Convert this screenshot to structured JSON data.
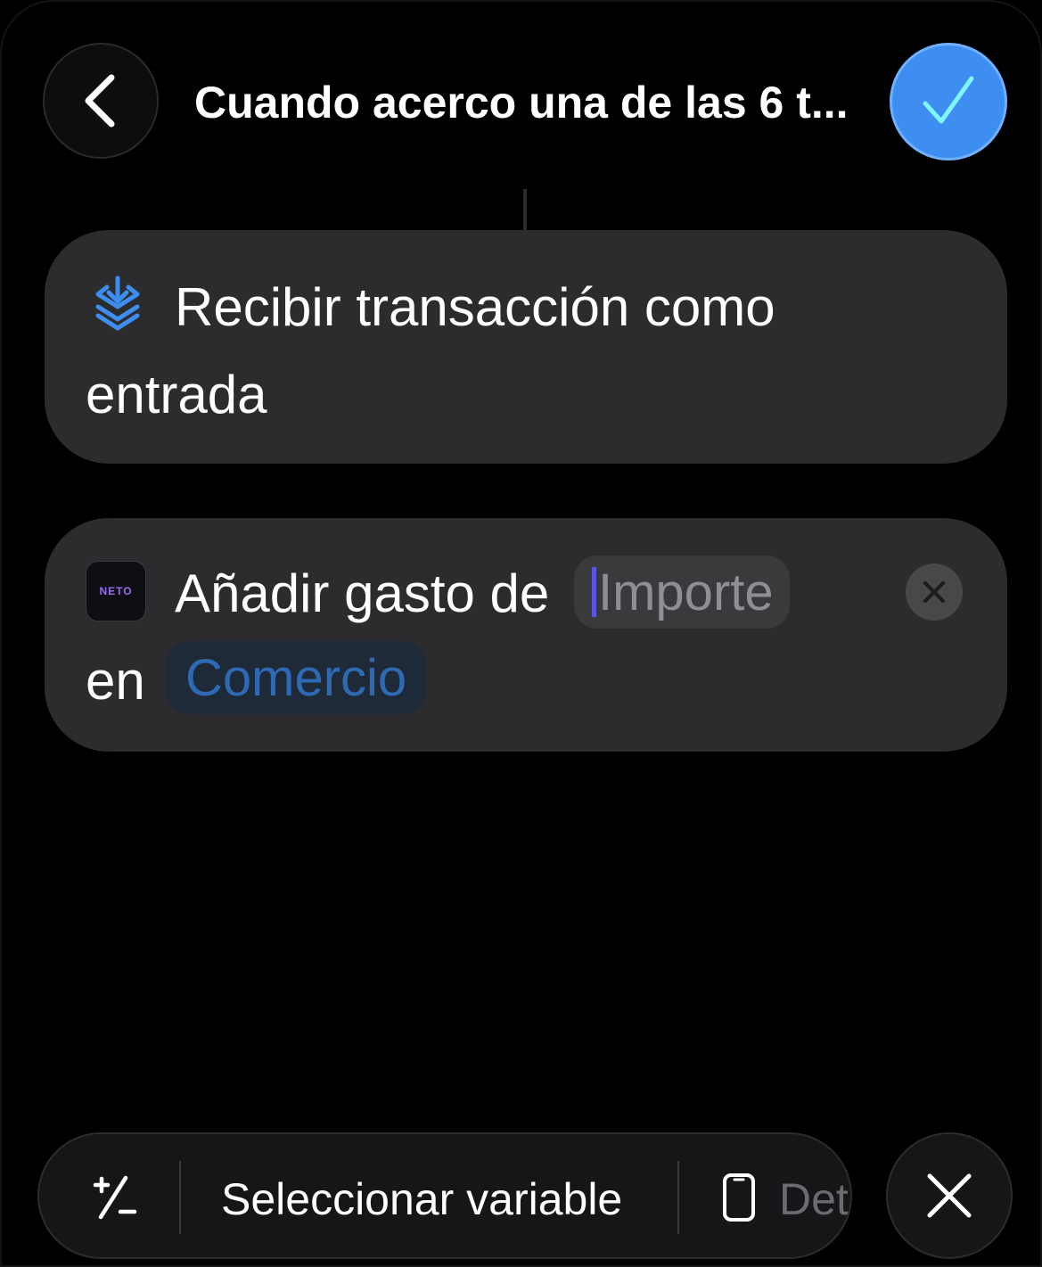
{
  "header": {
    "title": "Cuando acerco una de las 6 t...",
    "back_icon": "chevron-left-icon",
    "done_icon": "checkmark-icon",
    "accent_color": "#3d8ef0"
  },
  "actions": [
    {
      "icon": "download-stack-icon",
      "line1": "Recibir transacción como",
      "line2": "entrada"
    },
    {
      "app_icon_label": "NETO",
      "line1": "Añadir gasto de",
      "param_amount": "Importe",
      "line2": "en",
      "param_merchant": "Comercio",
      "clear_icon": "xmark-circle-icon"
    }
  ],
  "toolbar": {
    "plus_minus_icon": "plus-minus-icon",
    "select_variable": "Seleccionar variable",
    "device_icon": "iphone-icon",
    "device_label": "Det",
    "close_icon": "close-icon"
  }
}
